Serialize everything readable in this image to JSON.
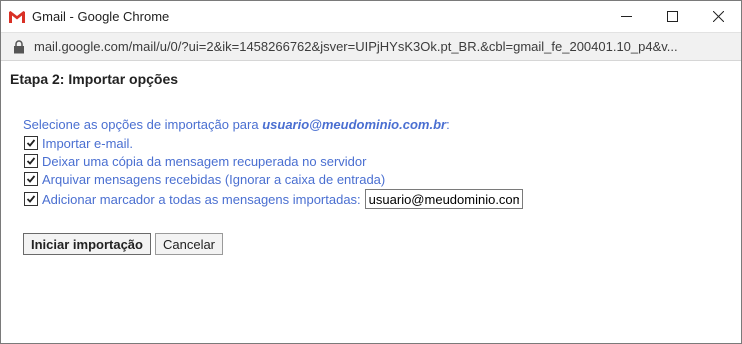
{
  "window": {
    "title": "Gmail - Google Chrome",
    "url": "mail.google.com/mail/u/0/?ui=2&ik=1458266762&jsver=UIPjHYsK3Ok.pt_BR.&cbl=gmail_fe_200401.10_p4&v..."
  },
  "page": {
    "heading": "Etapa 2: Importar opções",
    "instruction_prefix": "Selecione as opções de importação para ",
    "instruction_email": "usuario@meudominio.com.br",
    "instruction_suffix": ":"
  },
  "options": [
    {
      "label": "Importar e-mail.",
      "checked": true
    },
    {
      "label": "Deixar uma cópia da mensagem recuperada no servidor",
      "checked": true
    },
    {
      "label": "Arquivar mensagens recebidas (Ignorar a caixa de entrada)",
      "checked": true
    },
    {
      "label": "Adicionar marcador a todas as mensagens importadas:",
      "checked": true
    }
  ],
  "label_input_value": "usuario@meudominio.com.br",
  "buttons": {
    "start": "Iniciar importação",
    "cancel": "Cancelar"
  },
  "colors": {
    "link_blue": "#4a6fd1",
    "gmail_red": "#d93025"
  },
  "icons": {
    "app": "gmail-icon",
    "lock": "lock-icon",
    "minimize": "minimize-icon",
    "maximize": "maximize-icon",
    "close": "close-icon",
    "check": "checkmark-icon"
  }
}
